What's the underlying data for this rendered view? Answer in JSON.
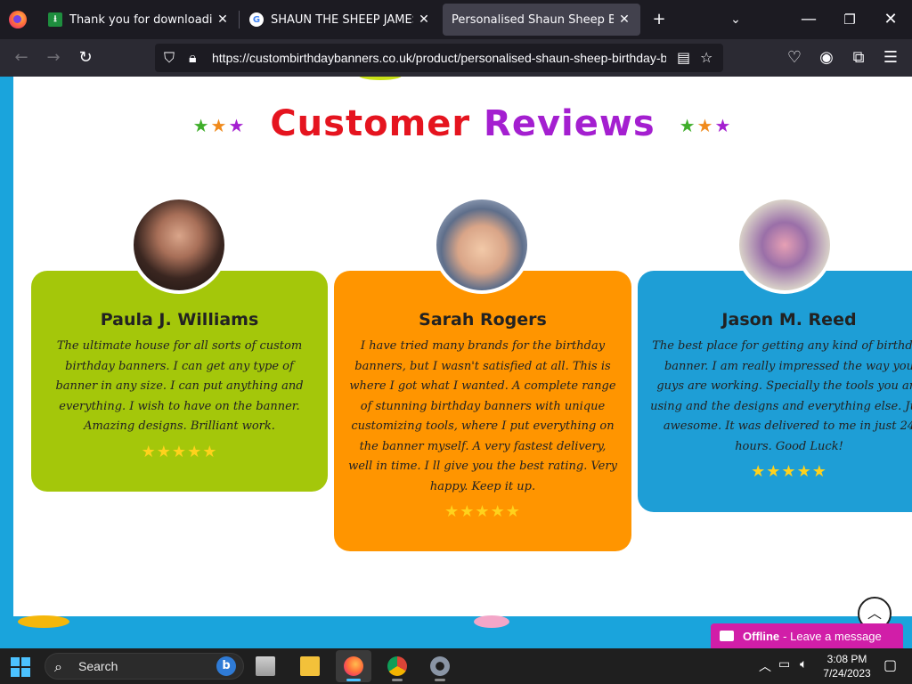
{
  "browser": {
    "tabs": [
      {
        "title": "Thank you for downloading Ad",
        "favicon": "download-favicon",
        "active": false
      },
      {
        "title": "SHAUN THE SHEEP JAMES BIRH",
        "favicon": "google-favicon",
        "active": false
      },
      {
        "title": "Personalised Shaun Sheep Birthday",
        "favicon": "none",
        "active": true
      }
    ],
    "new_tab_icon": "plus-icon",
    "url": "https://custombirthdaybanners.co.uk/product/personalised-shaun-sheep-birthday-b"
  },
  "page": {
    "heading": {
      "word1": "Customer",
      "word2": "Reviews",
      "stars": "★★★"
    },
    "reviews": [
      {
        "name": "Paula J. Williams",
        "text": "The ultimate house for all sorts of custom birthday banners. I can get any type of banner in any size. I can put anything and everything. I wish to have on the banner. Amazing designs. Brilliant work.",
        "stars": "★★★★★",
        "rating": 5,
        "color": "#a4c70a"
      },
      {
        "name": "Sarah Rogers",
        "text": "I have tried many brands for the birthday banners, but I wasn't satisfied at all. This is where I got what I wanted. A complete range of stunning birthday banners with unique customizing tools, where I put everything on the banner myself. A very fastest delivery, well in time. I ll give you the best rating. Very happy. Keep it up.",
        "stars": "★★★★★",
        "rating": 5,
        "color": "#ff9500"
      },
      {
        "name": "Jason M. Reed",
        "text": "The best place for getting any kind of birthday banner. I am really impressed the way you guys are working. Specially the tools you are using and the designs and everything else. Just awesome. It was delivered to me in just 24 hours. Good Luck!",
        "stars": "★★★★★",
        "rating": 5,
        "color": "#1e9ed6"
      }
    ],
    "scroll_top_icon": "chevron-up-icon",
    "chat": {
      "status": "Offline",
      "message": "- Leave a message"
    }
  },
  "taskbar": {
    "search_label": "Search",
    "apps": [
      "task-view",
      "file-explorer",
      "firefox",
      "chrome",
      "settings"
    ],
    "clock_time": "3:08 PM",
    "clock_date": "7/24/2023"
  }
}
